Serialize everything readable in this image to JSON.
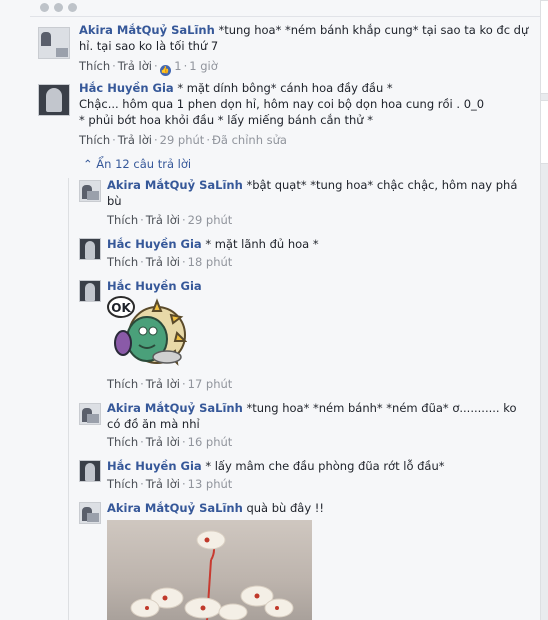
{
  "comments": [
    {
      "author": "Akira MắtQuỷ SaLĩnh",
      "text_line1": "*tung hoa* *ném bánh khắp cung* tại sao ta ko đc dự",
      "text_line2": "hỉ. tại sao ko là tối thứ 7",
      "like": "Thích",
      "reply": "Trả lời",
      "like_count": "1",
      "time": "1 giờ"
    },
    {
      "author": "Hắc Huyền Gia",
      "text_line1": "* mặt dính bông* cánh hoa đầy đầu *",
      "text_line2": "Chậc... hôm qua 1 phen dọn hỉ, hôm nay coi bộ dọn hoa cung rồi . 0_0",
      "text_line3": "* phủi bớt hoa khỏi đầu * lấy miếng bánh cắn thử *",
      "like": "Thích",
      "reply": "Trả lời",
      "time": "29 phút",
      "edited": "Đã chỉnh sửa"
    }
  ],
  "toggle_label": "Ẩn 12 câu trả lời",
  "replies": [
    {
      "author": "Akira MắtQuỷ SaLĩnh",
      "text_line1": "*bật quạt* *tung hoa* chậc chậc, hôm nay phá",
      "text_line2": "bù",
      "like": "Thích",
      "reply": "Trả lời",
      "time": "29 phút"
    },
    {
      "author": "Hắc Huyền Gia",
      "text_line1": "* mặt lãnh đủ hoa *",
      "like": "Thích",
      "reply": "Trả lời",
      "time": "18 phút"
    },
    {
      "author": "Hắc Huyền Gia",
      "sticker_text": "OK",
      "like": "Thích",
      "reply": "Trả lời",
      "time": "17 phút"
    },
    {
      "author": "Akira MắtQuỷ SaLĩnh",
      "text_line1": "*tung hoa* *ném bánh* *ném đũa* ơ........... ko",
      "text_line2": "có đồ ăn mà nhỉ",
      "like": "Thích",
      "reply": "Trả lời",
      "time": "16 phút"
    },
    {
      "author": "Hắc Huyền Gia",
      "text_line1": "* lấy mâm che đầu phòng đũa rớt lỗ đầu*",
      "like": "Thích",
      "reply": "Trả lời",
      "time": "13 phút"
    },
    {
      "author": "Akira MắtQuỷ SaLĩnh",
      "text_line1": "quà bù đây !!"
    }
  ],
  "colors": {
    "link": "#365899",
    "meta": "#90949c",
    "like_badge": "#4267b2"
  }
}
